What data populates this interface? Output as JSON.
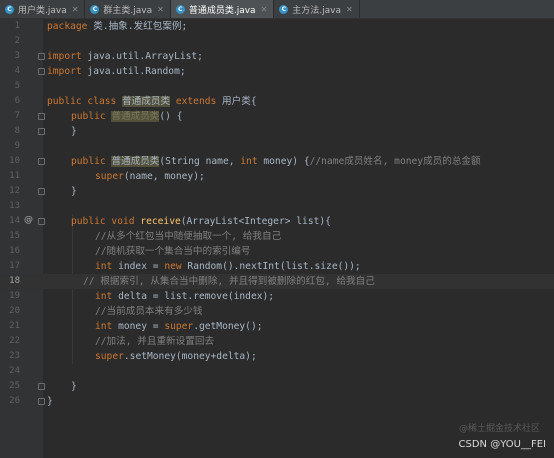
{
  "tabs": [
    {
      "label": "用户类.java",
      "active": false
    },
    {
      "label": "群主类.java",
      "active": false
    },
    {
      "label": "普通成员类.java",
      "active": true
    },
    {
      "label": "主方法.java",
      "active": false
    }
  ],
  "editor": {
    "current_line": "18",
    "lines": [
      {
        "n": "1"
      },
      {
        "n": "2"
      },
      {
        "n": "3"
      },
      {
        "n": "4"
      },
      {
        "n": "5"
      },
      {
        "n": "6"
      },
      {
        "n": "7"
      },
      {
        "n": "8"
      },
      {
        "n": "9"
      },
      {
        "n": "10"
      },
      {
        "n": "11"
      },
      {
        "n": "12"
      },
      {
        "n": "13"
      },
      {
        "n": "14"
      },
      {
        "n": "15"
      },
      {
        "n": "16"
      },
      {
        "n": "17"
      },
      {
        "n": "18"
      },
      {
        "n": "19"
      },
      {
        "n": "20"
      },
      {
        "n": "21"
      },
      {
        "n": "22"
      },
      {
        "n": "23"
      },
      {
        "n": "24"
      },
      {
        "n": "25"
      },
      {
        "n": "26"
      }
    ],
    "code": {
      "l1_kw": "package",
      "l1_rest": " 类.抽象.发红包案例;",
      "l3_kw": "import",
      "l3_rest": " java.util.ArrayList;",
      "l4_kw": "import",
      "l4_rest": " java.util.Random;",
      "l6_kw1": "public class ",
      "l6_cls": "普通成员类",
      "l6_kw2": " extends ",
      "l6_rest": "用户类{",
      "l7_kw": "public ",
      "l7_name": "普通成员类",
      "l7_rest": "() {",
      "l8": "}",
      "l10_kw": "public ",
      "l10_name": "普通成员类",
      "l10_a": "(String name, ",
      "l10_kw2": "int",
      "l10_b": " money) {",
      "l10_cm": "//name成员姓名, money成员的总金额",
      "l11_kw": "super",
      "l11_rest": "(name, money);",
      "l12": "}",
      "l14_kw": "public void ",
      "l14_fn": "receive",
      "l14_rest": "(ArrayList<Integer> list){",
      "l15": "//从多个红包当中随便抽取一个, 给我自己",
      "l16": "//随机获取一个集合当中的索引编号",
      "l17_kw": "int",
      "l17_a": " index = ",
      "l17_kw2": "new",
      "l17_b": " Random().nextInt(list.size());",
      "l18": "// 根据索引, 从集合当中删除, 并且得到被删除的红包, 给我自己",
      "l19_kw": "int",
      "l19_rest": " delta = list.remove(index);",
      "l20": "//当前成员本来有多少钱",
      "l21_kw": "int",
      "l21_a": " money = ",
      "l21_kw2": "super",
      "l21_b": ".getMoney();",
      "l22": "//加法, 并且重新设置回去",
      "l23_kw": "super",
      "l23_rest": ".setMoney(money+delta);",
      "l25": "}",
      "l26": "}"
    }
  },
  "watermark": {
    "text": "CSDN @YOU__FEI",
    "faint": "@稀土掘金技术社区"
  }
}
